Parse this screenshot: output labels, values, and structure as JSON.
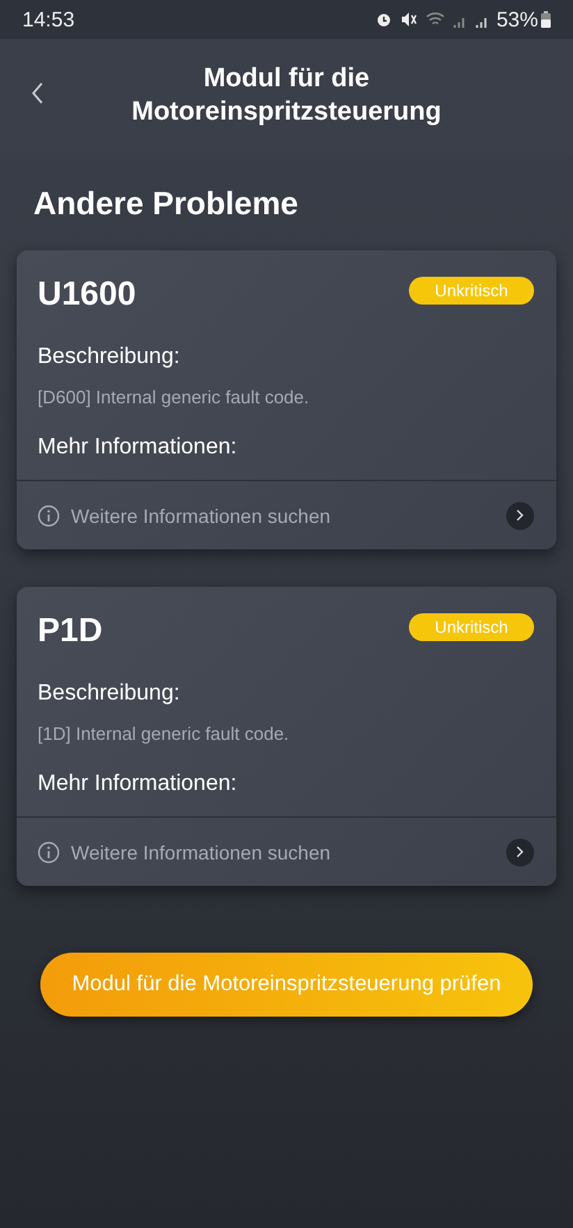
{
  "status_bar": {
    "time": "14:53",
    "battery": "53%"
  },
  "header": {
    "title": "Modul für die Motoreinspritzsteuerung"
  },
  "section_title": "Andere Probleme",
  "faults": [
    {
      "code": "U1600",
      "severity": "Unkritisch",
      "description_label": "Beschreibung:",
      "description": "[D600] Internal generic fault code.",
      "more_label": "Mehr Informationen:",
      "search_link": "Weitere Informationen suchen"
    },
    {
      "code": "P1D",
      "severity": "Unkritisch",
      "description_label": "Beschreibung:",
      "description": "[1D] Internal generic fault code.",
      "more_label": "Mehr Informationen:",
      "search_link": "Weitere Informationen suchen"
    }
  ],
  "action_button": "Modul für die Motoreinspritzsteuerung prüfen"
}
